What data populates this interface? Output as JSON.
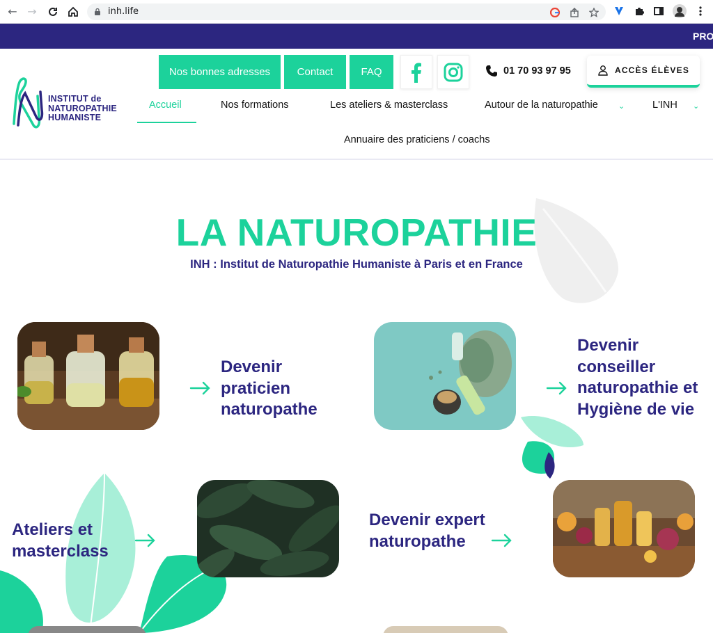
{
  "browser": {
    "url": "inh.life"
  },
  "promo_bar": {
    "text": "PRO"
  },
  "header": {
    "logo_lines": [
      "INSTITUT de",
      "NATUROPATHIE",
      "HUMANISTE"
    ],
    "top_buttons": [
      "Nos bonnes adresses",
      "Contact",
      "FAQ"
    ],
    "phone": "01 70 93 97 95",
    "access_label": "ACCÈS ÉLÈVES",
    "menu": [
      "Accueil",
      "Nos formations",
      "Les ateliers & masterclass",
      "Autour de la naturopathie",
      "L'INH",
      "Annuaire des praticiens / coachs"
    ]
  },
  "hero": {
    "title": "LA NATUROPATHIE",
    "subtitle": "INH : Institut de Naturopathie Humaniste à Paris et en France"
  },
  "cards": {
    "praticien": "Devenir praticien naturopathe",
    "conseiller": "Devenir conseiller naturopathie et Hygiène de vie",
    "ateliers": "Ateliers et masterclass",
    "expert": "Devenir expert naturopathe"
  },
  "colors": {
    "brand_purple": "#2c2680",
    "brand_green": "#1cd29b"
  },
  "icons": [
    "back-icon",
    "forward-icon",
    "reload-icon",
    "home-icon",
    "lock-icon",
    "google-icon",
    "share-icon",
    "star-icon",
    "extension-icon",
    "puzzle-icon",
    "sidebar-icon",
    "profile-icon",
    "menu-dots-icon",
    "facebook-icon",
    "instagram-icon",
    "phone-icon",
    "user-icon",
    "arrow-right-icon"
  ]
}
